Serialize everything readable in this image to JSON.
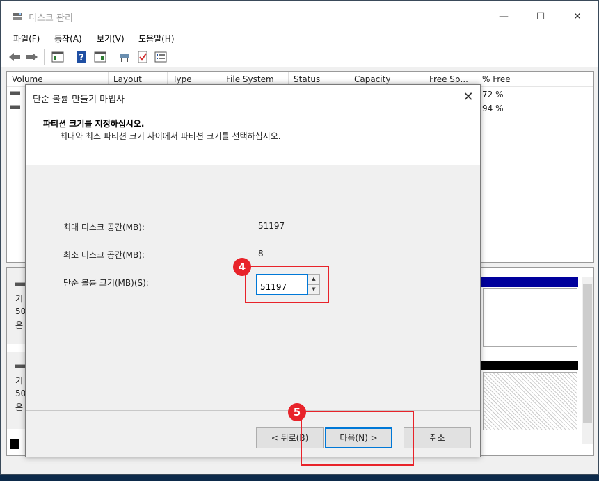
{
  "window": {
    "title": "디스크 관리",
    "min_glyph": "—",
    "max_glyph": "☐",
    "close_glyph": "✕"
  },
  "menu": {
    "file": "파일(F)",
    "action": "동작(A)",
    "view": "보기(V)",
    "help": "도움말(H)"
  },
  "toolbar": {
    "icons": [
      "back-arrow-icon",
      "forward-arrow-icon",
      "console-tree-icon",
      "help-icon",
      "action-pane-icon",
      "connect-icon",
      "properties-check-icon",
      "list-view-icon"
    ]
  },
  "volume_list": {
    "columns": [
      "Volume",
      "Layout",
      "Type",
      "File System",
      "Status",
      "Capacity",
      "Free Sp...",
      "% Free"
    ],
    "rows": [
      {
        "free_pct": "72 %"
      },
      {
        "free_pct": "94 %"
      }
    ]
  },
  "graphic_view": {
    "disk0_lines": [
      "기",
      "50.",
      "온"
    ],
    "disk1_lines": [
      "기",
      "50.",
      "온"
    ]
  },
  "wizard": {
    "title": "단순 볼륨 만들기 마법사",
    "close_glyph": "✕",
    "heading": "파티션 크기를 지정하십시오.",
    "subheading": "최대와 최소 파티션 크기 사이에서 파티션 크기를 선택하십시오.",
    "max_label": "최대 디스크 공간(MB):",
    "max_value": "51197",
    "min_label": "최소 디스크 공간(MB):",
    "min_value": "8",
    "size_label": "단순 볼륨 크기(MB)(S):",
    "size_value": "51197",
    "spin_up": "▲",
    "spin_down": "▼",
    "back_button": "< 뒤로(B)",
    "next_button": "다음(N) >",
    "cancel_button": "취소"
  },
  "annotations": {
    "step4": "4",
    "step5": "5",
    "highlight_color": "#e8232a"
  }
}
